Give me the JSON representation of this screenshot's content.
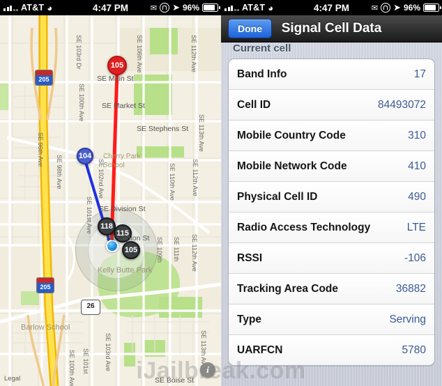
{
  "status_bar": {
    "carrier": "AT&T",
    "time": "4:47 PM",
    "battery_percent": "96%",
    "icons": [
      "signal-bars-icon",
      "wifi-icon",
      "envelope-icon",
      "rotation-lock-icon",
      "location-arrow-icon",
      "battery-charging-icon"
    ]
  },
  "map": {
    "legal_link": "Legal",
    "info_button": "i",
    "highway_shields": [
      {
        "name": "I-205 north shield",
        "number": "205",
        "type": "interstate"
      },
      {
        "name": "I-205 south shield",
        "number": "205",
        "type": "interstate"
      },
      {
        "name": "US-26 shield",
        "number": "26",
        "type": "us-route"
      }
    ],
    "markers": [
      {
        "label": "105",
        "color": "#e02020",
        "kind": "red-pin"
      },
      {
        "label": "104",
        "color": "#4a5fd0",
        "kind": "blue-pin"
      },
      {
        "label": "118",
        "color": "#3b3f42",
        "kind": "dark-pin"
      },
      {
        "label": "115",
        "color": "#3b3f42",
        "kind": "dark-pin"
      },
      {
        "label": "105",
        "color": "#3b3f42",
        "kind": "dark-pin"
      }
    ],
    "street_labels": [
      "SE Main St",
      "SE Market St",
      "SE Stephens St",
      "SE Division St",
      "SE Clinton St",
      "SE Boise St",
      "SE 96th Ave",
      "SE 98th Ave",
      "SE 100th Ave",
      "SE 101st Ave",
      "SE 102nd Ave",
      "SE 103rd Dr",
      "SE 106th Ave",
      "SE 109th",
      "SE 110th Ave",
      "SE 111th",
      "SE 112th Ave",
      "SE 113th Ave",
      "SE 103rd Ave",
      "SE 100th Ave",
      "SE 101st"
    ],
    "place_labels": [
      "Cherry Park School",
      "Kelly Butte Park",
      "Barlow School"
    ]
  },
  "nav": {
    "done_label": "Done",
    "title": "Signal Cell Data"
  },
  "section": {
    "header": "Current cell",
    "rows": [
      {
        "label": "Band Info",
        "value": "17"
      },
      {
        "label": "Cell ID",
        "value": "84493072"
      },
      {
        "label": "Mobile Country Code",
        "value": "310"
      },
      {
        "label": "Mobile Network Code",
        "value": "410"
      },
      {
        "label": "Physical Cell ID",
        "value": "490"
      },
      {
        "label": "Radio Access Technology",
        "value": "LTE"
      },
      {
        "label": "RSSI",
        "value": "-106"
      },
      {
        "label": "Tracking Area Code",
        "value": "36882"
      },
      {
        "label": "Type",
        "value": "Serving"
      },
      {
        "label": "UARFCN",
        "value": "5780"
      }
    ]
  },
  "watermark": {
    "text": "iJailbreak.com"
  },
  "colors": {
    "accent": "#3b5a92",
    "done_button": "#1e63d8",
    "marker_red": "#e02020",
    "marker_blue": "#4a5fd0"
  }
}
